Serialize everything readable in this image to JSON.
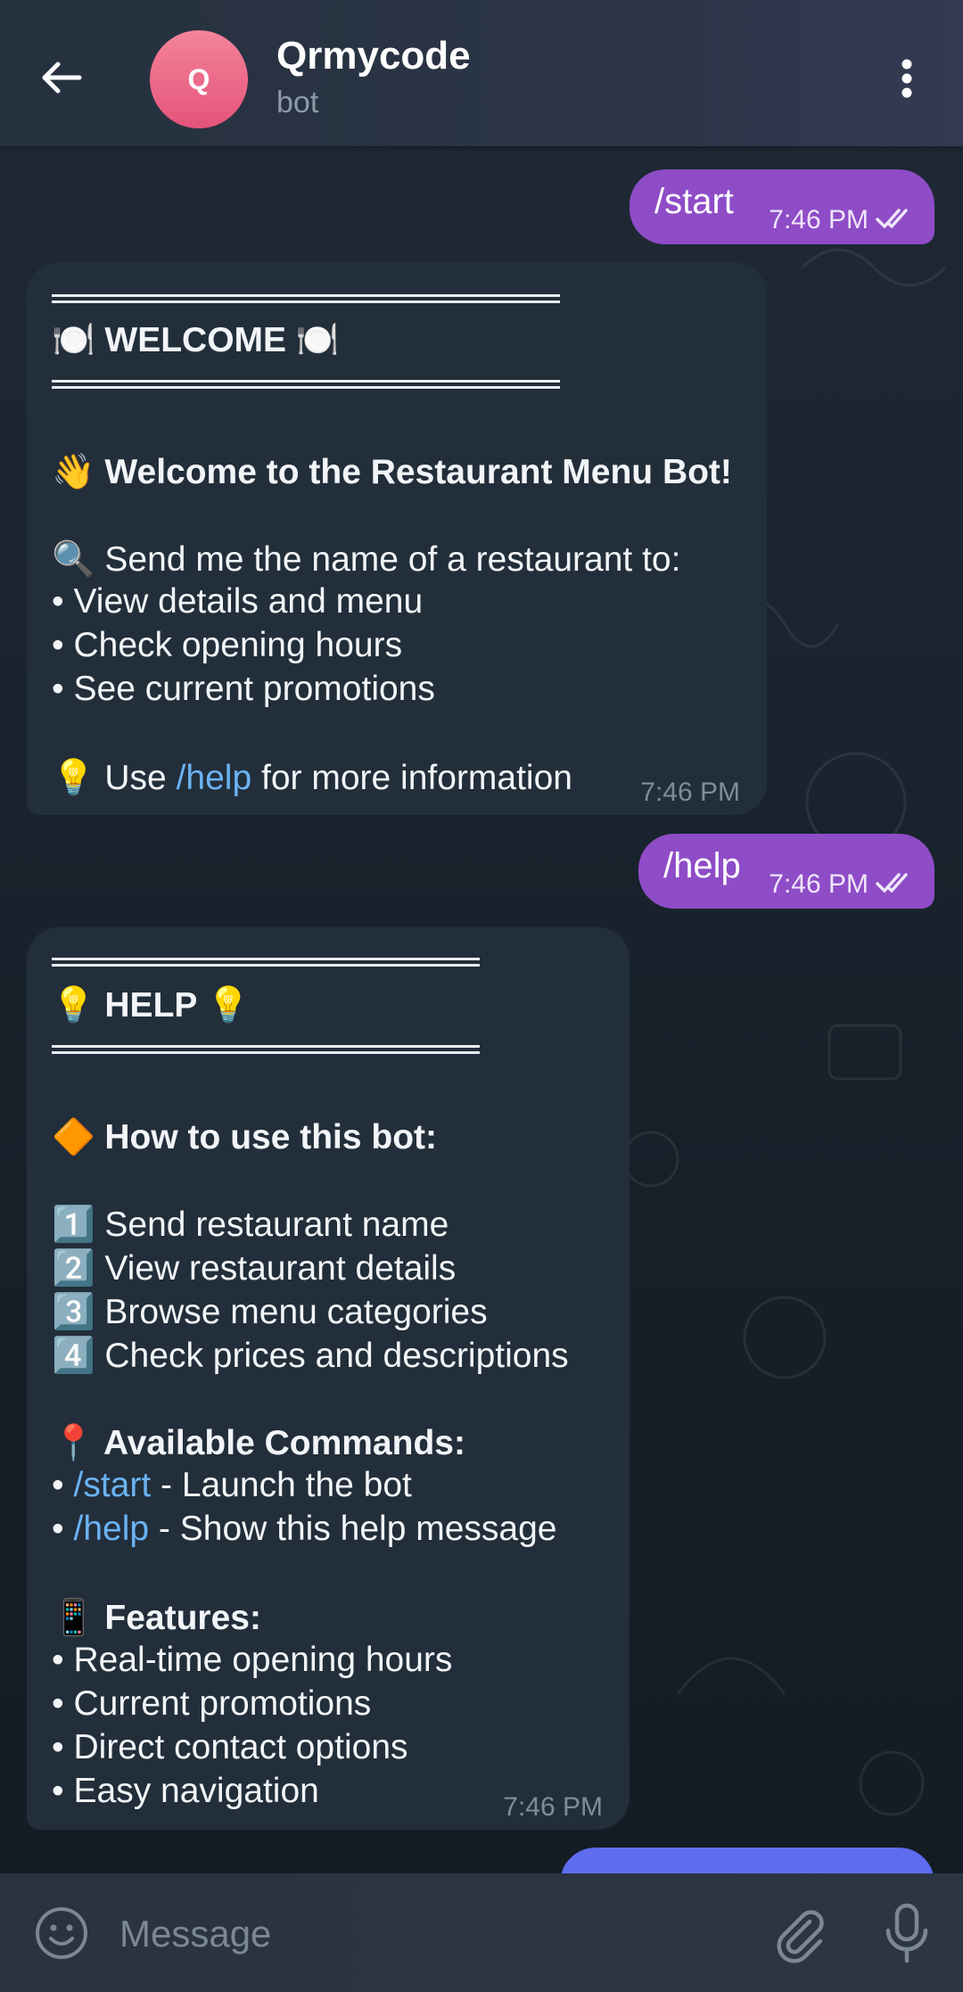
{
  "header": {
    "avatar_letter": "Q",
    "title": "Qrmycode",
    "subtitle": "bot"
  },
  "messages": {
    "start": {
      "text": "/start",
      "time": "7:46 PM"
    },
    "welcome": {
      "heading": "🍽️ WELCOME 🍽️",
      "greeting": "👋 Welcome to the Restaurant Menu Bot!",
      "intro": "🔍 Send me the name of a restaurant to:",
      "bullets": [
        "• View details and menu",
        "• Check opening hours",
        "• See current promotions"
      ],
      "footer_prefix": "💡 Use ",
      "footer_link": "/help",
      "footer_suffix": " for more information",
      "time": "7:46 PM"
    },
    "help_cmd": {
      "text": "/help",
      "time": "7:46 PM"
    },
    "help": {
      "heading": "💡 HELP 💡",
      "howto": "🔶 How to use this bot:",
      "steps": [
        "1️⃣ Send restaurant name",
        "2️⃣ View restaurant details",
        "3️⃣ Browse menu categories",
        "4️⃣ Check prices and descriptions"
      ],
      "commands_title": "📍 Available Commands:",
      "commands": [
        {
          "prefix": "• ",
          "cmd": "/start",
          "desc": " - Launch the bot"
        },
        {
          "prefix": "• ",
          "cmd": "/help",
          "desc": " - Show this help message"
        }
      ],
      "features_title": "📱 Features:",
      "features": [
        "• Real-time opening hours",
        "• Current promotions",
        "• Direct contact options",
        "• Easy navigation"
      ],
      "time": "7:46 PM"
    }
  },
  "input": {
    "placeholder": "Message"
  },
  "colors": {
    "outgoing_bubble": "#8e4cc7",
    "incoming_bubble": "#232e3b",
    "link": "#6ab3f3",
    "avatar": "#e5537a"
  }
}
